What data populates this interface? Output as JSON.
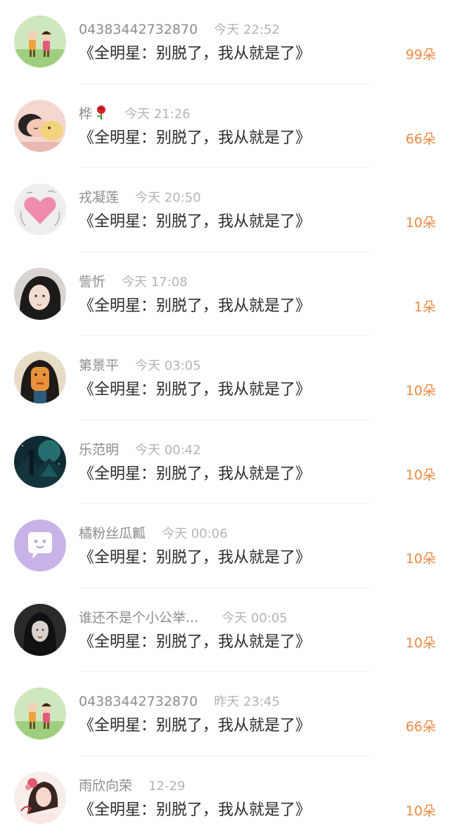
{
  "comments": [
    {
      "name": "04383442732870",
      "time": "今天 22:52",
      "title": "《全明星：别脱了，我从就是了》",
      "flowers": "99朵",
      "avatar_icon": "cartoon-kids-avatar-icon"
    },
    {
      "name": "桦",
      "time": "今天 21:26",
      "title": "《全明星：别脱了，我从就是了》",
      "flowers": "66朵",
      "avatar_icon": "sleeping-baby-avatar-icon",
      "name_emoji": "rose-icon"
    },
    {
      "name": "戎凝莲",
      "time": "今天 20:50",
      "title": "《全明星：别脱了，我从就是了》",
      "flowers": "10朵",
      "avatar_icon": "pink-heart-avatar-icon"
    },
    {
      "name": "訾忻",
      "time": "今天 17:08",
      "title": "《全明星：别脱了，我从就是了》",
      "flowers": "1朵",
      "avatar_icon": "girl-portrait-avatar-icon"
    },
    {
      "name": "第景平",
      "time": "今天 03:05",
      "title": "《全明星：别脱了，我从就是了》",
      "flowers": "10朵",
      "avatar_icon": "illustrated-face-avatar-icon"
    },
    {
      "name": "乐范明",
      "time": "今天 00:42",
      "title": "《全明星：别脱了，我从就是了》",
      "flowers": "10朵",
      "avatar_icon": "dark-scenery-avatar-icon"
    },
    {
      "name": "橘粉丝瓜瓤",
      "time": "今天 00:06",
      "title": "《全明星：别脱了，我从就是了》",
      "flowers": "10朵",
      "avatar_icon": "chat-bubble-avatar-icon"
    },
    {
      "name": "谁还不是个小公举...",
      "time": "今天 00:05",
      "title": "《全明星：别脱了，我从就是了》",
      "flowers": "10朵",
      "avatar_icon": "ink-girl-avatar-icon"
    },
    {
      "name": "04383442732870",
      "time": "昨天 23:45",
      "title": "《全明星：别脱了，我从就是了》",
      "flowers": "66朵",
      "avatar_icon": "cartoon-kids-avatar-icon"
    },
    {
      "name": "雨欣向荣",
      "time": "12-29",
      "title": "《全明星：别脱了，我从就是了》",
      "flowers": "10朵",
      "avatar_icon": "calligraphy-girl-avatar-icon"
    }
  ],
  "colors": {
    "name": "#8c8c8c",
    "time": "#b4b4b4",
    "title": "#2b2b2b",
    "flowers": "#ee8a44",
    "chat_avatar_bg": "#c7b3e8"
  }
}
